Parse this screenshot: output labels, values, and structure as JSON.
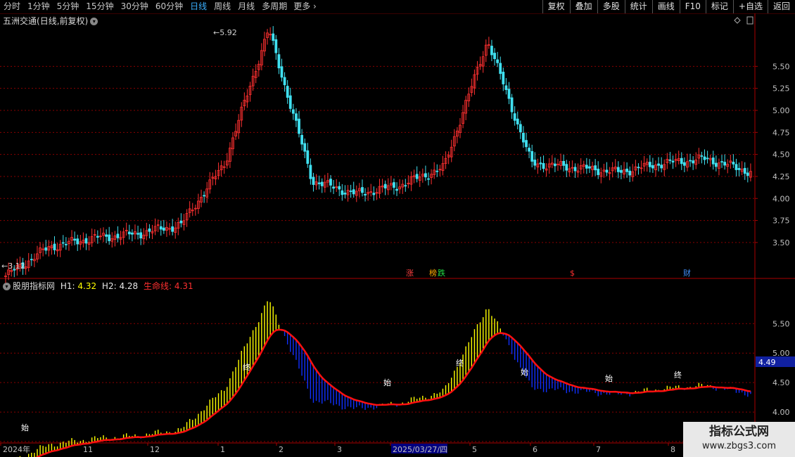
{
  "toolbar": {
    "periods": [
      "分时",
      "1分钟",
      "5分钟",
      "15分钟",
      "30分钟",
      "60分钟",
      "日线",
      "周线",
      "月线",
      "多周期"
    ],
    "active_period": "日线",
    "more_label": "更多",
    "right_buttons": [
      "复权",
      "叠加",
      "多股",
      "统计",
      "画线",
      "F10",
      "标记",
      "+自选",
      "返回"
    ]
  },
  "main_chart": {
    "stock_name": "五洲交通",
    "period_desc": "(日线,前复权)",
    "high_label": "5.92",
    "low_label": "3.12",
    "markers": [
      {
        "text": "涨",
        "color": "#ff4040"
      },
      {
        "text": "榜",
        "color": "#ffaa00"
      },
      {
        "text": "跌",
        "color": "#22dd44"
      },
      {
        "text": "$",
        "color": "#ff3030"
      },
      {
        "text": "财",
        "color": "#4090ff"
      }
    ]
  },
  "indicator": {
    "name": "股朋指标网",
    "h1_label": "H1:",
    "h1_value": "4.32",
    "h2_label": "H2:",
    "h2_value": "4.28",
    "life_label": "生命线:",
    "life_value": "4.31",
    "price_tag": "4.49",
    "shi_label": "始",
    "zhong_label": "终"
  },
  "xaxis": {
    "labels": [
      "2024年",
      "11",
      "12",
      "1",
      "2",
      "3",
      "2025/03/27/四",
      "5",
      "6",
      "7",
      "8"
    ]
  },
  "chart_data": {
    "type": "candlestick",
    "main_axis_ticks": [
      5.5,
      5.25,
      5.0,
      4.75,
      4.5,
      4.25,
      4.0,
      3.75,
      3.5
    ],
    "main_ylim": [
      3.1,
      5.95
    ],
    "indicator_axis_ticks": [
      5.5,
      5.0,
      4.5,
      4.0,
      3.5
    ],
    "indicator_ylim": [
      3.5,
      6.1
    ],
    "series": [
      {
        "name": "H1",
        "values_end": 4.32
      },
      {
        "name": "H2",
        "values_end": 4.28
      },
      {
        "name": "生命线",
        "values_end": 4.31
      }
    ],
    "key_prices": [
      3.12,
      3.45,
      3.55,
      3.6,
      3.7,
      4.4,
      5.92,
      4.2,
      4.05,
      4.15,
      4.35,
      5.8,
      4.4,
      4.35,
      4.3,
      4.4,
      4.45,
      4.3
    ]
  },
  "colors": {
    "up": "#ff3030",
    "down": "#40e0f0",
    "grid": "#8a0000",
    "life_line": "#ff1010",
    "yellow_band": "#ffff00",
    "blue_band": "#1030ff"
  },
  "watermark": {
    "line1": "指标公式网",
    "line2": "www.zbgs3.com"
  }
}
